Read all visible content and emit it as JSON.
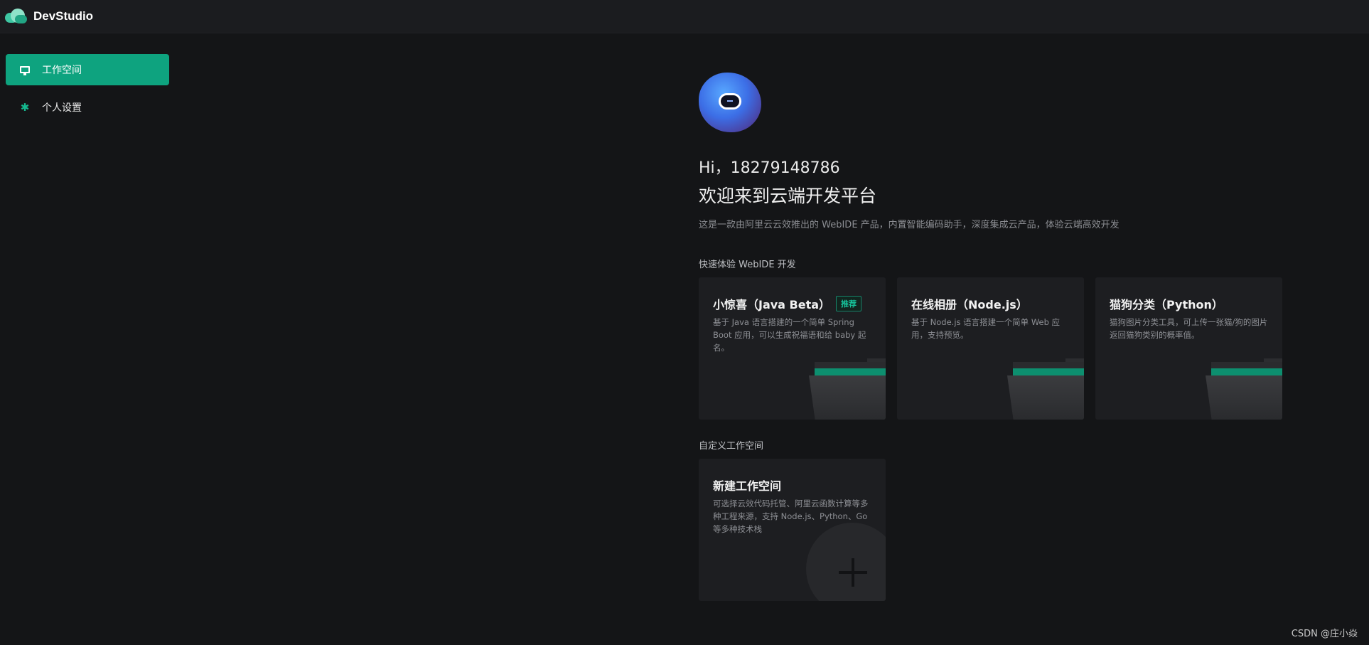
{
  "header": {
    "app_title": "DevStudio",
    "logo_icon": "cloud-logo-icon"
  },
  "sidebar": {
    "items": [
      {
        "label": "工作空间",
        "icon": "monitor-icon",
        "active": true
      },
      {
        "label": "个人设置",
        "icon": "gear-icon",
        "active": false
      }
    ]
  },
  "welcome": {
    "greeting": "Hi，18279148786",
    "headline": "欢迎来到云端开发平台",
    "description": "这是一款由阿里云云效推出的 WebIDE 产品，内置智能编码助手，深度集成云产品，体验云端高效开发"
  },
  "quickstart": {
    "section_title": "快速体验 WebIDE 开发",
    "cards": [
      {
        "title": "小惊喜（Java Beta）",
        "badge": "推荐",
        "desc": "基于 Java 语言搭建的一个简单 Spring Boot 应用，可以生成祝福语和给 baby 起名。"
      },
      {
        "title": "在线相册（Node.js）",
        "desc": "基于 Node.js 语言搭建一个简单 Web 应用，支持预览。"
      },
      {
        "title": "猫狗分类（Python）",
        "desc": "猫狗图片分类工具，可上传一张猫/狗的图片返回猫狗类别的概率值。"
      }
    ]
  },
  "custom": {
    "section_title": "自定义工作空间",
    "card": {
      "title": "新建工作空间",
      "desc": "可选择云效代码托管、阿里云函数计算等多种工程来源，支持 Node.js、Python、Go 等多种技术栈"
    }
  },
  "watermark": "CSDN @庄小焱",
  "colors": {
    "accent": "#0ea37f",
    "background": "#141517",
    "card": "#1d1e21",
    "topbar": "#1b1c1f"
  }
}
